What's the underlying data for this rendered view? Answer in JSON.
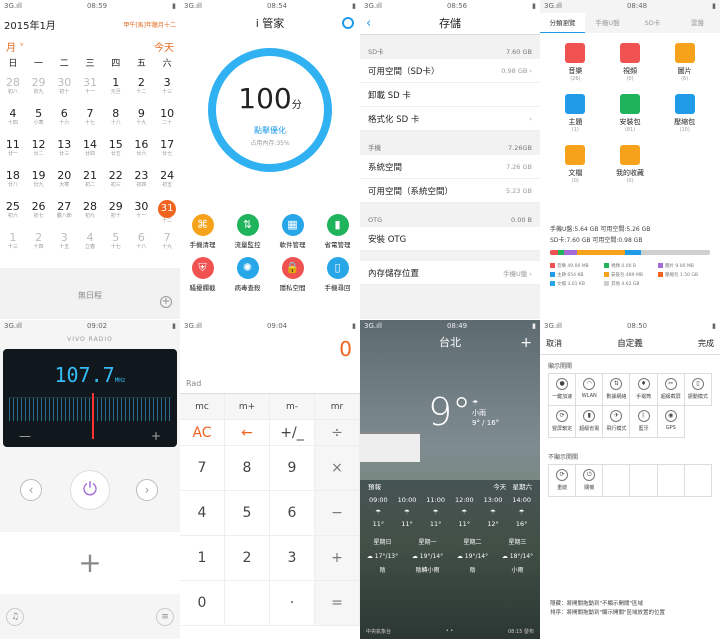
{
  "calendar": {
    "status": {
      "left": "3G.ıll",
      "time": "08:59"
    },
    "year_month": "2015年1月",
    "lunar": "甲午[馬]年臘月十二",
    "view_mode": "月",
    "today_button": "今天",
    "weekdays": [
      "日",
      "一",
      "二",
      "三",
      "四",
      "五",
      "六"
    ],
    "days": [
      {
        "d": "28",
        "l": "初八",
        "dim": true
      },
      {
        "d": "29",
        "l": "初九",
        "dim": true
      },
      {
        "d": "30",
        "l": "初十",
        "dim": true
      },
      {
        "d": "31",
        "l": "十一",
        "dim": true
      },
      {
        "d": "1",
        "l": "元旦"
      },
      {
        "d": "2",
        "l": "十二"
      },
      {
        "d": "3",
        "l": "十三"
      },
      {
        "d": "4",
        "l": "十四"
      },
      {
        "d": "5",
        "l": "小寒"
      },
      {
        "d": "6",
        "l": "十六"
      },
      {
        "d": "7",
        "l": "十七"
      },
      {
        "d": "8",
        "l": "十八"
      },
      {
        "d": "9",
        "l": "十九"
      },
      {
        "d": "10",
        "l": "二十"
      },
      {
        "d": "11",
        "l": "廿一"
      },
      {
        "d": "12",
        "l": "廿二"
      },
      {
        "d": "13",
        "l": "廿三"
      },
      {
        "d": "14",
        "l": "廿四"
      },
      {
        "d": "15",
        "l": "廿五"
      },
      {
        "d": "16",
        "l": "廿六"
      },
      {
        "d": "17",
        "l": "廿七"
      },
      {
        "d": "18",
        "l": "廿八"
      },
      {
        "d": "19",
        "l": "廿九"
      },
      {
        "d": "20",
        "l": "大寒"
      },
      {
        "d": "21",
        "l": "初二"
      },
      {
        "d": "22",
        "l": "初三"
      },
      {
        "d": "23",
        "l": "初四"
      },
      {
        "d": "24",
        "l": "初五"
      },
      {
        "d": "25",
        "l": "初六"
      },
      {
        "d": "26",
        "l": "初七"
      },
      {
        "d": "27",
        "l": "臘八節"
      },
      {
        "d": "28",
        "l": "初九"
      },
      {
        "d": "29",
        "l": "初十"
      },
      {
        "d": "30",
        "l": "十一"
      },
      {
        "d": "31",
        "l": "十二",
        "today": true
      },
      {
        "d": "1",
        "l": "十三",
        "dim": true
      },
      {
        "d": "2",
        "l": "十四",
        "dim": true
      },
      {
        "d": "3",
        "l": "十五",
        "dim": true
      },
      {
        "d": "4",
        "l": "立春",
        "dim": true
      },
      {
        "d": "5",
        "l": "十七",
        "dim": true
      },
      {
        "d": "6",
        "l": "十八",
        "dim": true
      },
      {
        "d": "7",
        "l": "十九",
        "dim": true
      }
    ],
    "no_schedule": "無日程"
  },
  "manager": {
    "status": {
      "left": "3G.ıll",
      "time": "08:54"
    },
    "title": "i 管家",
    "score": "100",
    "score_unit": "分",
    "optimize": "點擊優化",
    "memory": "占用內存:35%",
    "tools": [
      {
        "label": "手機清理",
        "color": "#f7a21b",
        "glyph": "⌘"
      },
      {
        "label": "流量監控",
        "color": "#1fb35c",
        "glyph": "⇅"
      },
      {
        "label": "軟件管理",
        "color": "#27a6e8",
        "glyph": "▦"
      },
      {
        "label": "省電管理",
        "color": "#1fb35c",
        "glyph": "▮"
      },
      {
        "label": "騷擾攔截",
        "color": "#ef5250",
        "glyph": "⛨"
      },
      {
        "label": "病毒查殺",
        "color": "#27a6e8",
        "glyph": "✺"
      },
      {
        "label": "隱私空間",
        "color": "#ef5250",
        "glyph": "🔒"
      },
      {
        "label": "手機尋回",
        "color": "#27a6e8",
        "glyph": "▯"
      }
    ]
  },
  "storage": {
    "status": {
      "left": "3G.ıll",
      "time": "08:56"
    },
    "title": "存儲",
    "sd_label": "SD卡",
    "sd_total": "7.60 GB",
    "sd_rows": [
      {
        "label": "可用空間（SD卡）",
        "value": "0.98 GB",
        "arrow": true
      },
      {
        "label": "卸載 SD 卡",
        "value": "",
        "arrow": false
      },
      {
        "label": "格式化 SD 卡",
        "value": "",
        "arrow": true
      }
    ],
    "phone_label": "手機",
    "phone_total": "7.26GB",
    "phone_rows": [
      {
        "label": "系統空間",
        "value": "7.26 GB",
        "arrow": false
      },
      {
        "label": "可用空間（系統空間）",
        "value": "5.23 GB",
        "arrow": false
      }
    ],
    "otg_label": "OTG",
    "otg_total": "0.00 B",
    "otg_row": "安裝 OTG",
    "location_label": "內存儲存位置",
    "location_value": "手機U盤"
  },
  "files": {
    "status": {
      "left": "3G.ıll",
      "time": "08:48"
    },
    "tabs": [
      "分類瀏覽",
      "手機U盤",
      "SD卡",
      "雲盤"
    ],
    "items": [
      {
        "label": "音樂",
        "count": "(26)",
        "color": "#ef5250"
      },
      {
        "label": "視頻",
        "count": "(0)",
        "color": "#ef5250"
      },
      {
        "label": "圖片",
        "count": "(6)",
        "color": "#f7a21b"
      },
      {
        "label": "主題",
        "count": "(1)",
        "color": "#1f9be8"
      },
      {
        "label": "安裝包",
        "count": "(81)",
        "color": "#1fb35c"
      },
      {
        "label": "壓縮包",
        "count": "(10)",
        "color": "#1f9be8"
      },
      {
        "label": "文檔",
        "count": "(0)",
        "color": "#f7a21b"
      },
      {
        "label": "我的收藏",
        "count": "(0)",
        "color": "#f7a21b"
      }
    ],
    "stat1": "手機U盤:5.64 GB   可用空間:5.26 GB",
    "stat2": "SD卡:7.60 GB   可用空間:0.98 GB",
    "bar": [
      {
        "color": "#ef5250",
        "share": 0.05
      },
      {
        "color": "#1fb35c",
        "share": 0.04
      },
      {
        "color": "#a56bd8",
        "share": 0.08
      },
      {
        "color": "#f7a21b",
        "share": 0.3
      },
      {
        "color": "#1f9be8",
        "share": 0.1
      },
      {
        "color": "#cfcfcf",
        "share": 0.43
      }
    ],
    "legend": [
      {
        "label": "音樂 49.00 MB",
        "color": "#ef5250"
      },
      {
        "label": "視頻 0.00 B",
        "color": "#1fb35c"
      },
      {
        "label": "圖片 9.00 MB",
        "color": "#a56bd8"
      },
      {
        "label": "主題 654 KB",
        "color": "#1f9be8"
      },
      {
        "label": "安裝包 489 MB",
        "color": "#f7a21b"
      },
      {
        "label": "壓縮包 1.50 GB",
        "color": "#f06420"
      },
      {
        "label": "文檔 3.01 KB",
        "color": "#27a6e8"
      },
      {
        "label": "其他 4.62 GB",
        "color": "#cfcfcf"
      }
    ]
  },
  "radio": {
    "status": {
      "left": "3G.ıll",
      "time": "09:02"
    },
    "brand": "VIVO RADIO",
    "freq": "107.7",
    "freq_unit": "MHz",
    "minus": "—",
    "plus": "+",
    "prev": "‹",
    "next": "›",
    "power": "⏻",
    "add": "+",
    "headset": "♫",
    "list": "≡"
  },
  "calculator": {
    "status": {
      "left": "3G.ıll",
      "time": "09:04"
    },
    "display": "0",
    "mode": "Rad",
    "keys": [
      {
        "k": "mc",
        "c": "sm"
      },
      {
        "k": "m+",
        "c": "sm"
      },
      {
        "k": "m-",
        "c": "sm"
      },
      {
        "k": "mr",
        "c": "sm"
      },
      {
        "k": "AC",
        "c": "or"
      },
      {
        "k": "←",
        "c": "or"
      },
      {
        "k": "+/_",
        "c": ""
      },
      {
        "k": "÷",
        "c": "op"
      },
      {
        "k": "7",
        "c": ""
      },
      {
        "k": "8",
        "c": ""
      },
      {
        "k": "9",
        "c": ""
      },
      {
        "k": "×",
        "c": "op"
      },
      {
        "k": "4",
        "c": ""
      },
      {
        "k": "5",
        "c": ""
      },
      {
        "k": "6",
        "c": ""
      },
      {
        "k": "−",
        "c": "op"
      },
      {
        "k": "1",
        "c": ""
      },
      {
        "k": "2",
        "c": ""
      },
      {
        "k": "3",
        "c": ""
      },
      {
        "k": "+",
        "c": "op"
      },
      {
        "k": "0",
        "c": ""
      },
      {
        "k": "",
        "c": ""
      },
      {
        "k": "·",
        "c": ""
      },
      {
        "k": "=",
        "c": "op"
      }
    ]
  },
  "weather": {
    "status": {
      "left": "3G.ıll",
      "time": "08:49"
    },
    "city": "台北",
    "add": "+",
    "temp": "9°",
    "condition": "小雨",
    "range": "9° / 16°",
    "forecast_label": "預報",
    "today_label": "今天",
    "today_day": "星期六",
    "hours": [
      "09:00",
      "10:00",
      "11:00",
      "12:00",
      "13:00",
      "14:00"
    ],
    "hour_temps": [
      "11°",
      "11°",
      "11°",
      "11°",
      "12°",
      "16°"
    ],
    "days": [
      {
        "day": "星期日",
        "hi": "17°",
        "lo": "13°",
        "cond": "陰"
      },
      {
        "day": "星期一",
        "hi": "19°",
        "lo": "14°",
        "cond": "陰轉小雨"
      },
      {
        "day": "星期二",
        "hi": "19°",
        "lo": "14°",
        "cond": "陰"
      },
      {
        "day": "星期三",
        "hi": "18°",
        "lo": "14°",
        "cond": "小雨"
      }
    ],
    "source": "中央氣象台",
    "update": "08:15 發布"
  },
  "custom": {
    "status": {
      "left": "3G.ıll",
      "time": "08:50"
    },
    "cancel": "取消",
    "title": "自定義",
    "done": "完成",
    "shown_label": "顯示開關",
    "shown": [
      {
        "label": "一鍵加速",
        "g": "●"
      },
      {
        "label": "WLAN",
        "g": "◠"
      },
      {
        "label": "數據網絡",
        "g": "⇅"
      },
      {
        "label": "手電筒",
        "g": "♦"
      },
      {
        "label": "超級截屏",
        "g": "✂"
      },
      {
        "label": "振動模式",
        "g": "▯"
      },
      {
        "label": "豎屏鎖定",
        "g": "⟳"
      },
      {
        "label": "超級省電",
        "g": "▮"
      },
      {
        "label": "飛行模式",
        "g": "✈"
      },
      {
        "label": "藍牙",
        "g": "ᛒ"
      },
      {
        "label": "GPS",
        "g": "◉"
      }
    ],
    "hidden_label": "不顯示開關",
    "hidden": [
      {
        "label": "重啟",
        "g": "⟳"
      },
      {
        "label": "關機",
        "g": "⏻"
      }
    ],
    "note1": "隱藏：將開關拖動到\"不顯示開關\"區域",
    "note2": "排序：將開關拖動到\"顯示開關\"區域放置的位置"
  }
}
